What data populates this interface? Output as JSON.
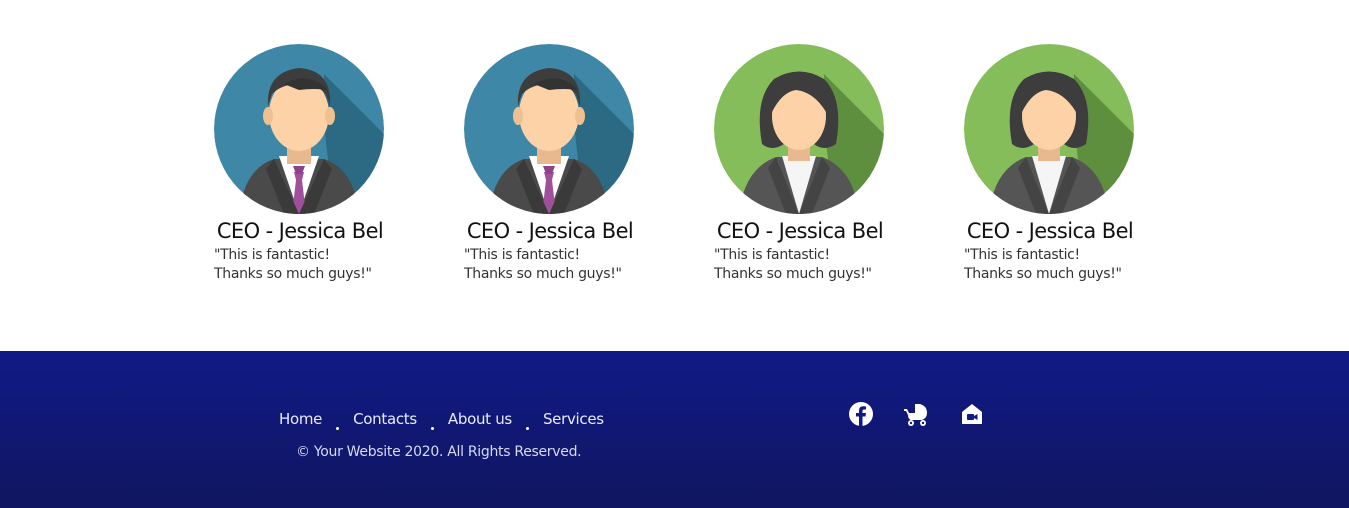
{
  "team": {
    "members": [
      {
        "name": "CEO - Jessica Bel",
        "quote": "\"This is fantastic! Thanks so much guys!\"",
        "avatar_icon": "man-avatar-icon"
      },
      {
        "name": "CEO - Jessica Bel",
        "quote": "\"This is fantastic! Thanks so much guys!\"",
        "avatar_icon": "man-avatar-icon"
      },
      {
        "name": "CEO - Jessica Bel",
        "quote": "\"This is fantastic! Thanks so much guys!\"",
        "avatar_icon": "woman-avatar-icon"
      },
      {
        "name": "CEO - Jessica Bel",
        "quote": "\"This is fantastic! Thanks so much guys!\"",
        "avatar_icon": "woman-avatar-icon"
      }
    ]
  },
  "footer": {
    "links": [
      "Home",
      "Contacts",
      "About us",
      "Services"
    ],
    "copyright": "© Your Website 2020. All Rights Reserved.",
    "social_icons": [
      "facebook-icon",
      "baby-carriage-icon",
      "house-video-icon"
    ]
  },
  "colors": {
    "footer_top": "#0f1a87",
    "footer_bottom": "#111660",
    "avatar_blue": "#3f87a6",
    "avatar_green": "#7ab552",
    "tie_purple": "#a0509a"
  }
}
